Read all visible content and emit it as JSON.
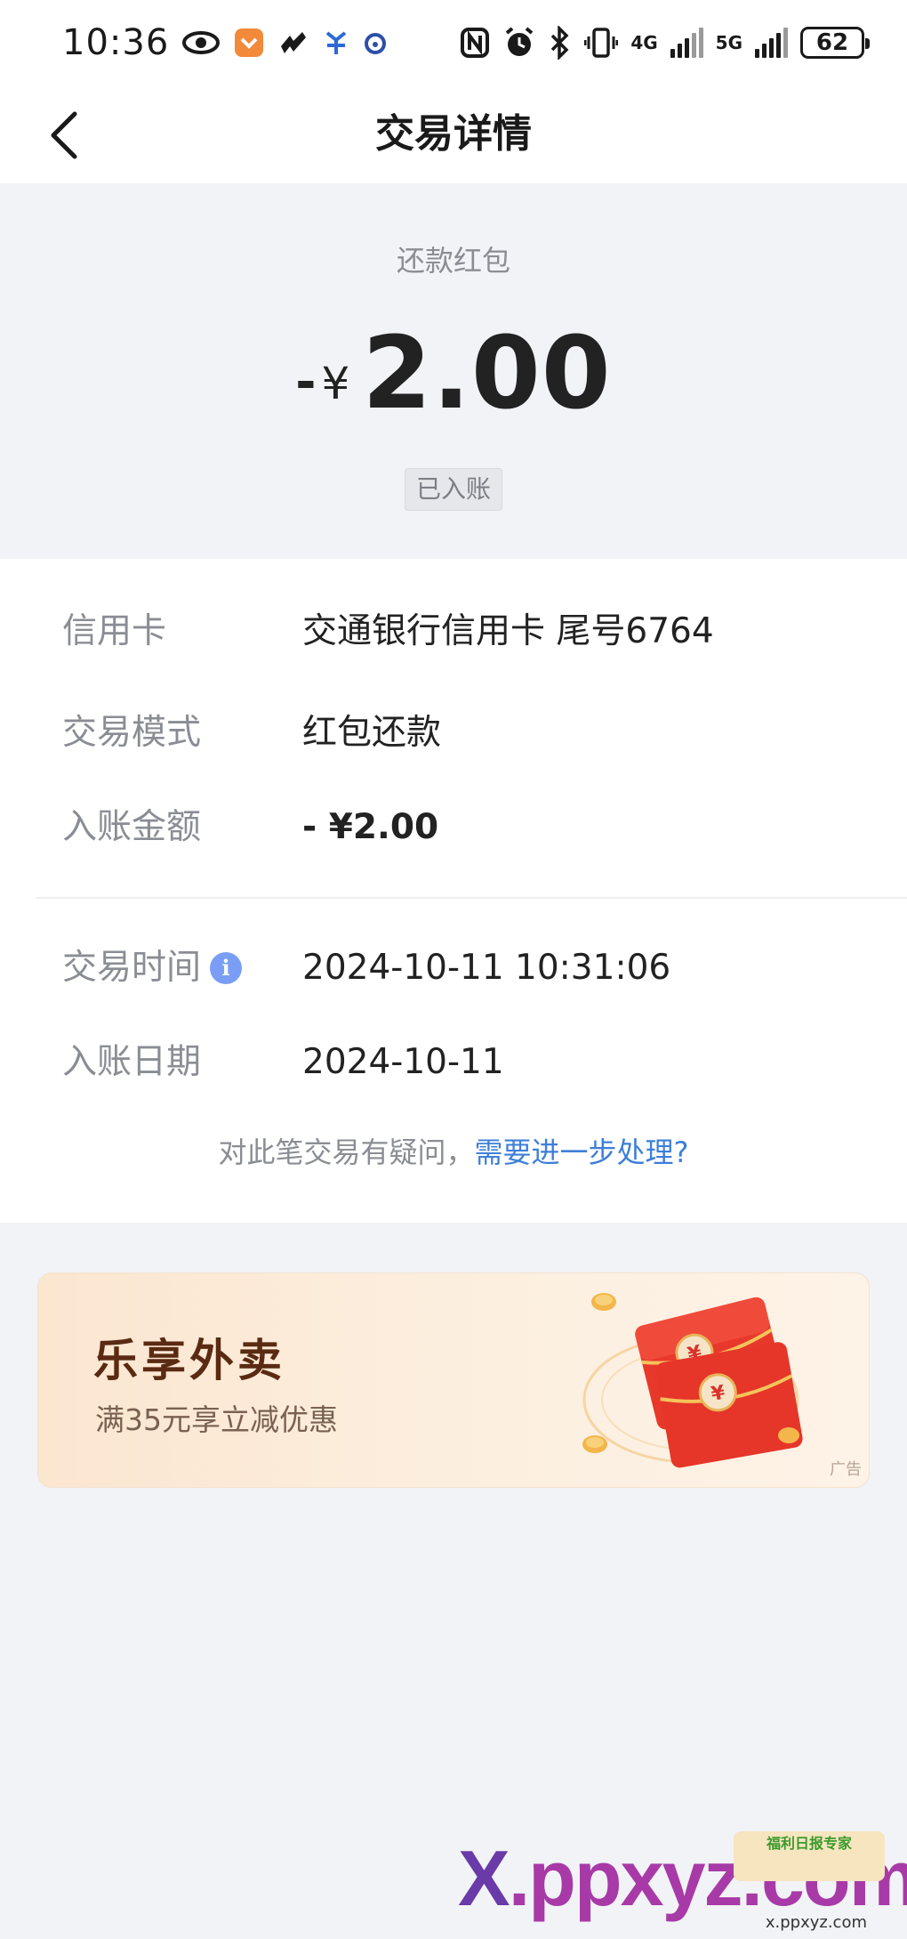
{
  "status_bar": {
    "time": "10:36",
    "battery": "62",
    "network_1": "4G",
    "network_2": "5G"
  },
  "nav": {
    "title": "交易详情"
  },
  "header": {
    "transaction_type": "还款红包",
    "amount_sign": "-",
    "currency": "¥",
    "amount": "2.00",
    "status": "已入账"
  },
  "details": {
    "card_label": "信用卡",
    "card_value": "交通银行信用卡 尾号6764",
    "mode_label": "交易模式",
    "mode_value": "红包还款",
    "posted_amount_label": "入账金额",
    "posted_amount_value": "- ¥2.00",
    "time_label": "交易时间",
    "time_value": "2024-10-11 10:31:06",
    "date_label": "入账日期",
    "date_value": "2024-10-11"
  },
  "help": {
    "question": "对此笔交易有疑问，",
    "link": "需要进一步处理?"
  },
  "ad": {
    "title": "乐享外卖",
    "subtitle": "满35元享立减优惠",
    "tag": "广告"
  },
  "watermark": {
    "text_x": "X",
    "text_rest": ".ppxyz.com",
    "badge": "福利日报专家",
    "url": "x.ppxyz.com"
  },
  "colors": {
    "link": "#3d7fd8",
    "info_icon": "#7a9ef6",
    "ad_title": "#5a2a12",
    "ad_red": "#e8382c"
  }
}
